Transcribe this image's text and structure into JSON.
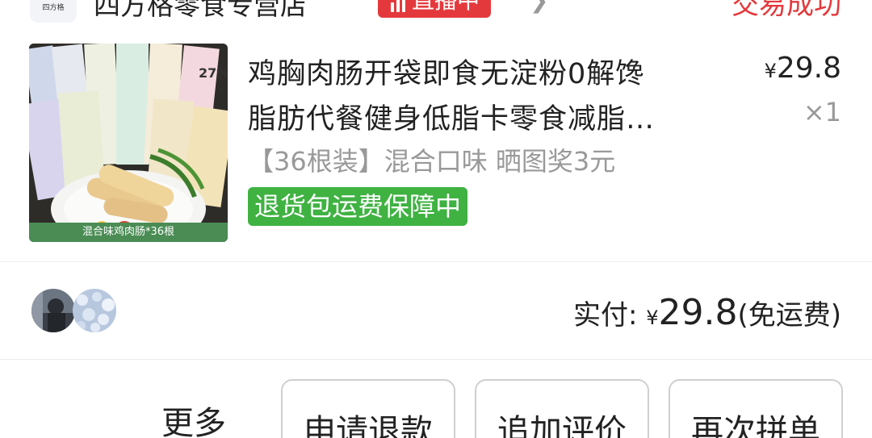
{
  "shop": {
    "logo_text": "四方格",
    "name": "四方格零食专营店",
    "live_badge": "直播中",
    "order_status": "交易成功"
  },
  "product": {
    "title_line1": "鸡胸肉肠开袋即食无淀粉0解馋",
    "title_line2": "脂肪代餐健身低脂卡零食减脂…",
    "image_caption": "混合味鸡肉肠*36根",
    "currency": "¥",
    "price": "29.8",
    "quantity": "×1",
    "variant": "【36根装】混合口味 晒图奖3元",
    "guarantee": "退货包运费保障中"
  },
  "payment": {
    "label": "实付: ",
    "currency": "¥",
    "amount": "29.8",
    "note": "(免运费)"
  },
  "actions": {
    "more": "更多",
    "refund": "申请退款",
    "add_review": "追加评价",
    "regroup": "再次拼单"
  },
  "colors": {
    "status_red": "#e4393c",
    "guarantee_green": "#3fb242",
    "muted_gray": "#999999"
  }
}
